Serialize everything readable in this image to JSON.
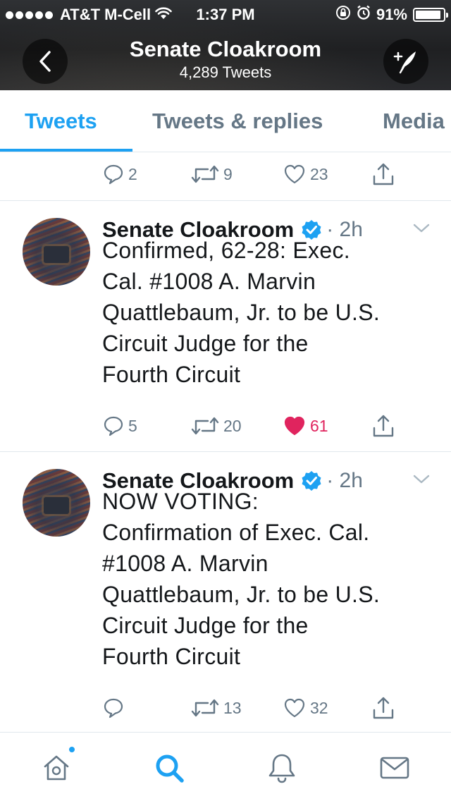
{
  "status_bar": {
    "carrier": "AT&T M-Cell",
    "time": "1:37 PM",
    "battery_percent": "91%",
    "battery_level": 0.91,
    "signal_bars": 5
  },
  "nav": {
    "title": "Senate Cloakroom",
    "subtitle": "4,289 Tweets",
    "back_icon": "back-arrow-icon",
    "compose_icon": "compose-tweet-icon"
  },
  "tabs": [
    {
      "label": "Tweets",
      "active": true
    },
    {
      "label": "Tweets & replies",
      "active": false
    },
    {
      "label": "Media",
      "active": false
    }
  ],
  "top_actions": {
    "replies": "2",
    "retweets": "9",
    "likes": "23"
  },
  "tweets": [
    {
      "author": "Senate Cloakroom",
      "verified": true,
      "time": "· 2h",
      "text": "Confirmed, 62-28: Exec.\nCal. #1008 A. Marvin\nQuattlebaum, Jr. to be U.S.\nCircuit Judge for the\nFourth Circuit",
      "replies": "5",
      "retweets": "20",
      "likes": "61",
      "liked": true
    },
    {
      "author": "Senate Cloakroom",
      "verified": true,
      "time": "· 2h",
      "text": "NOW VOTING:\nConfirmation of Exec. Cal.\n#1008 A. Marvin\nQuattlebaum, Jr. to be U.S.\nCircuit Judge for the\nFourth Circuit",
      "replies": "",
      "retweets": "13",
      "likes": "32",
      "liked": false
    }
  ],
  "bottom_bar": [
    {
      "icon": "home-icon",
      "active": false,
      "notification": true
    },
    {
      "icon": "search-icon",
      "active": true,
      "notification": false
    },
    {
      "icon": "bell-icon",
      "active": false,
      "notification": false
    },
    {
      "icon": "mail-icon",
      "active": false,
      "notification": false
    }
  ],
  "colors": {
    "accent": "#1da1f2",
    "like": "#e0245e",
    "muted": "#657786",
    "text": "#14171a",
    "divider": "#e1e8ed"
  }
}
